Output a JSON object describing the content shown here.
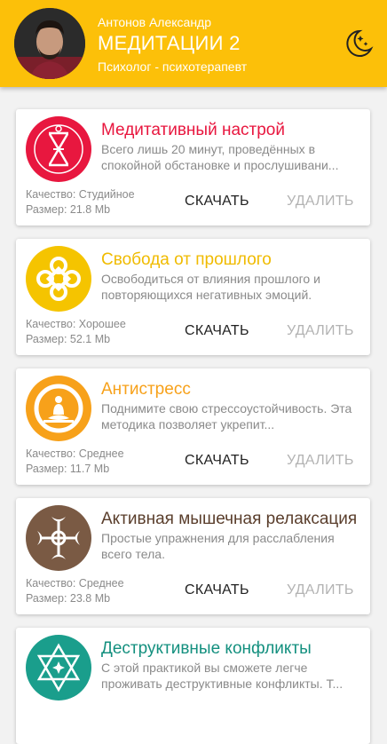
{
  "header": {
    "author": "Антонов Александр",
    "title": "МЕДИТАЦИИ 2",
    "subtitle": "Психолог - психотерапевт",
    "background_color": "#fcc009",
    "night_mode_icon": "moon-stars-icon"
  },
  "cards": [
    {
      "title": "Медитативный настрой",
      "description": "Всего лишь 20 минут, проведённых в спокойной обстановке и прослушивани...",
      "quality": "Качество: Студийное",
      "size": "Размер: 21.8 Mb",
      "download_label": "СКАЧАТЬ",
      "delete_label": "УДАЛИТЬ",
      "icon": "hourglass-symbol-icon",
      "accent_color": "#e8173f"
    },
    {
      "title": "Свобода от прошлого",
      "description": "Освободиться от влияния прошлого и повторяющихся негативных эмоций.",
      "quality": "Качество: Хорошее",
      "size": "Размер: 52.1 Mb",
      "download_label": "СКАЧАТЬ",
      "delete_label": "УДАЛИТЬ",
      "icon": "celtic-knot-icon",
      "accent_color": "#f5c400"
    },
    {
      "title": "Антистресс",
      "description": "Поднимите свою стрессоустойчивость. Эта методика позволяет укрепит...",
      "quality": "Качество: Среднее",
      "size": "Размер: 11.7 Mb",
      "download_label": "СКАЧАТЬ",
      "delete_label": "УДАЛИТЬ",
      "icon": "meditating-figure-icon",
      "accent_color": "#f7a11a"
    },
    {
      "title": "Активная мышечная релаксация",
      "description": "Простые упражнения для расслабления всего тела.",
      "quality": "Качество: Среднее",
      "size": "Размер: 23.8 Mb",
      "download_label": "СКАЧАТЬ",
      "delete_label": "УДАЛИТЬ",
      "icon": "moon-phases-cross-icon",
      "accent_color": "#7a5a44"
    },
    {
      "title": "Деструктивные конфликты",
      "description": "С этой практикой вы сможете легче проживать деструктивные конфликты. Т...",
      "quality": "",
      "size": "",
      "download_label": "",
      "delete_label": "",
      "icon": "star-of-david-icon",
      "accent_color": "#1a9e8c"
    }
  ]
}
